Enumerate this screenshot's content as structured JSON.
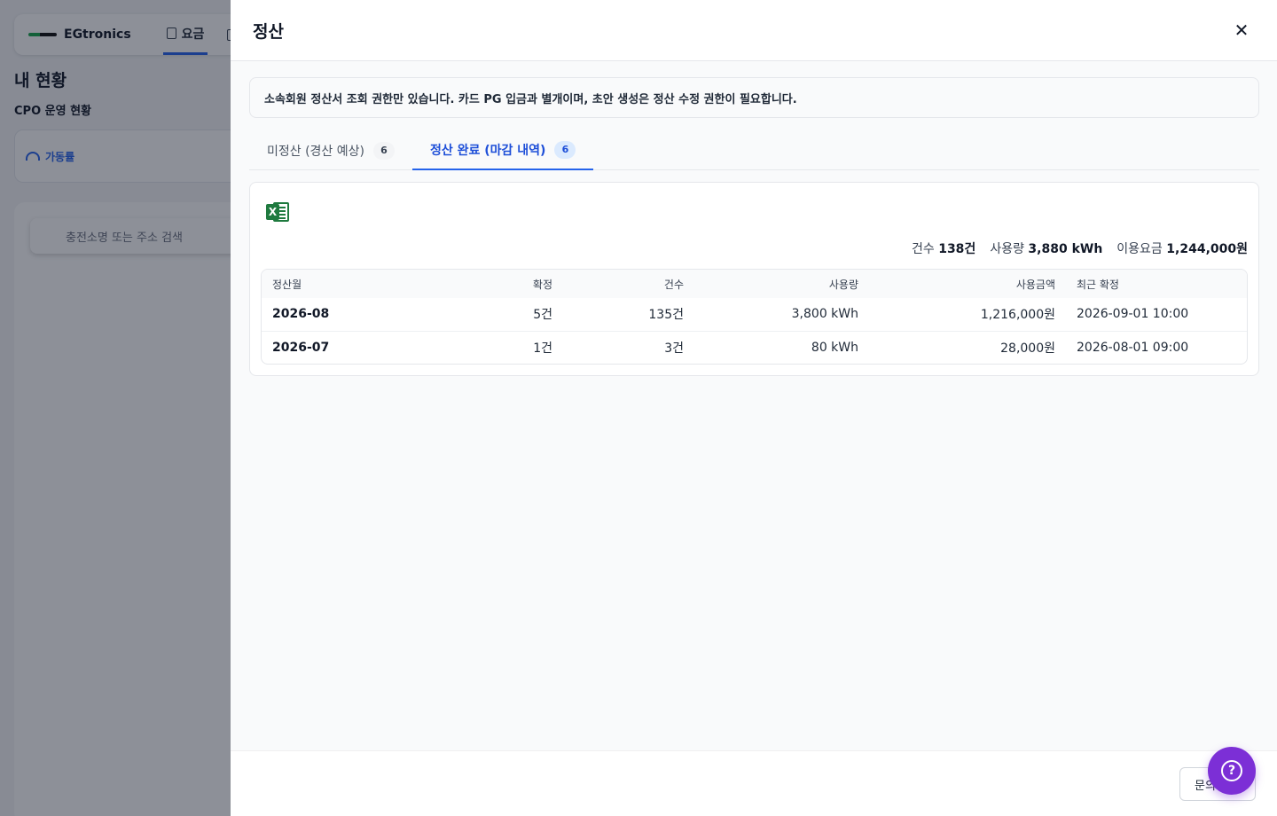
{
  "background": {
    "logo_text": "EGtronics",
    "nav_tab_label": "요금",
    "page_title": "내 현황",
    "section_title": "CPO 운영 현황",
    "card_label": "가동률",
    "search_placeholder": "충전소명 또는 주소 검색"
  },
  "drawer": {
    "title": "정산",
    "close_icon": "close-icon",
    "notice": "소속회원 정산서 조회 권한만 있습니다. 카드 PG 입금과 별개이며, 초안 생성은 정산 수정 권한이 필요합니다.",
    "tabs": [
      {
        "label": "미정산 (경산 예상)",
        "count": "6",
        "active": false
      },
      {
        "label": "정산 완료 (마감 내역)",
        "count": "6",
        "active": true
      }
    ],
    "excel_icon": "excel-export-icon",
    "summary": {
      "count_label": "건수",
      "count_value": "138건",
      "usage_label": "사용량",
      "usage_value": "3,880 kWh",
      "fee_label": "이용요금",
      "fee_value": "1,244,000원"
    },
    "table": {
      "headers": [
        "정산월",
        "확정",
        "건수",
        "사용량",
        "사용금액",
        "최근 확정"
      ],
      "rows": [
        {
          "month": "2026-08",
          "confirmed": "5건",
          "count": "135건",
          "usage": "3,800 kWh",
          "amount": "1,216,000원",
          "last_confirmed": "2026-09-01 10:00"
        },
        {
          "month": "2026-07",
          "confirmed": "1건",
          "count": "3건",
          "usage": "80 kWh",
          "amount": "28,000원",
          "last_confirmed": "2026-08-01 09:00"
        }
      ]
    },
    "footer": {
      "inquiry_label": "문의"
    }
  },
  "help_fab": {
    "icon": "help-question-icon",
    "symbol": "?"
  },
  "colors": {
    "accent": "#2563eb",
    "active_tab_text": "#1d4ed8",
    "excel_green": "#1f7a3f",
    "fab_purple": "#7c2fd6",
    "overlay": "rgba(17,24,39,0.48)"
  }
}
